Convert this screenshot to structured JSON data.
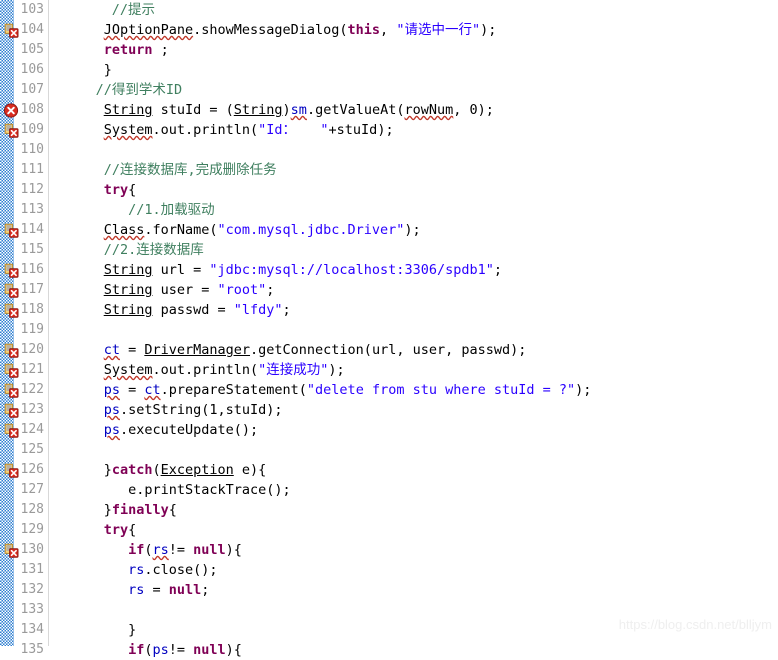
{
  "editor": {
    "name": "java-source-editor",
    "language": "Java",
    "first_line": 103,
    "last_line": 135,
    "colors": {
      "background": "#ffffff",
      "line_number": "#9a9a9a",
      "comment": "#3f7f5f",
      "keyword": "#7f0055",
      "string": "#2a00ff",
      "field": "#0000c0",
      "plain": "#000000",
      "hatch_marker": "#2f7fd0",
      "error_icon": "#d92c20",
      "quickfix_icon": "#f5c242",
      "watermark": "#efefef"
    }
  },
  "watermark": {
    "text": "https://blog.csdn.net/blljym"
  },
  "marker_types": {
    "error": "error-marker-icon",
    "quickfix_error": "quickfix-error-marker-icon",
    "none": ""
  },
  "lines": [
    {
      "number": "103",
      "marker": "none",
      "indent": 7,
      "tokens": [
        {
          "text": "//提示",
          "cls": "t-comment"
        }
      ]
    },
    {
      "number": "104",
      "marker": "quickfix_error",
      "indent": 6,
      "tokens": [
        {
          "text": "JOptionPane",
          "cls": "t-plain sqonly"
        },
        {
          "text": ".showMessageDialog(",
          "cls": "t-plain"
        },
        {
          "text": "this",
          "cls": "t-keyword"
        },
        {
          "text": ", ",
          "cls": "t-plain"
        },
        {
          "text": "\"请选中一行\"",
          "cls": "t-string"
        },
        {
          "text": ");",
          "cls": "t-plain"
        }
      ]
    },
    {
      "number": "105",
      "marker": "none",
      "indent": 6,
      "tokens": [
        {
          "text": "return",
          "cls": "t-keyword"
        },
        {
          "text": " ;",
          "cls": "t-plain"
        }
      ]
    },
    {
      "number": "106",
      "marker": "none",
      "indent": 6,
      "tokens": [
        {
          "text": "}",
          "cls": "t-plain"
        }
      ]
    },
    {
      "number": "107",
      "marker": "none",
      "indent": 5,
      "tokens": [
        {
          "text": "//得到学术ID",
          "cls": "t-comment"
        }
      ]
    },
    {
      "number": "108",
      "marker": "error",
      "indent": 6,
      "tokens": [
        {
          "text": "String",
          "cls": "t-plain ul-sq"
        },
        {
          "text": " stuId = (",
          "cls": "t-plain"
        },
        {
          "text": "String",
          "cls": "t-plain ul-sq"
        },
        {
          "text": ")",
          "cls": "t-plain"
        },
        {
          "text": "sm",
          "cls": "t-field sqonly"
        },
        {
          "text": ".getValueAt(",
          "cls": "t-plain"
        },
        {
          "text": "rowNum",
          "cls": "t-plain sqonly"
        },
        {
          "text": ", 0);",
          "cls": "t-plain"
        }
      ]
    },
    {
      "number": "109",
      "marker": "quickfix_error",
      "indent": 6,
      "tokens": [
        {
          "text": "System",
          "cls": "t-plain sqonly"
        },
        {
          "text": ".out.println(",
          "cls": "t-plain"
        },
        {
          "text": "\"Id：   \"",
          "cls": "t-string"
        },
        {
          "text": "+stuId);",
          "cls": "t-plain"
        }
      ]
    },
    {
      "number": "110",
      "marker": "none",
      "indent": 0,
      "tokens": []
    },
    {
      "number": "111",
      "marker": "none",
      "indent": 6,
      "tokens": [
        {
          "text": "//连接数据库,完成删除任务",
          "cls": "t-comment"
        }
      ]
    },
    {
      "number": "112",
      "marker": "none",
      "indent": 6,
      "tokens": [
        {
          "text": "try",
          "cls": "t-keyword"
        },
        {
          "text": "{",
          "cls": "t-plain"
        }
      ]
    },
    {
      "number": "113",
      "marker": "none",
      "indent": 9,
      "tokens": [
        {
          "text": "//1.加载驱动",
          "cls": "t-comment"
        }
      ]
    },
    {
      "number": "114",
      "marker": "quickfix_error",
      "indent": 6,
      "tokens": [
        {
          "text": "Class",
          "cls": "t-plain sqonly"
        },
        {
          "text": ".forName(",
          "cls": "t-plain"
        },
        {
          "text": "\"com.mysql.jdbc.Driver\"",
          "cls": "t-string"
        },
        {
          "text": ");",
          "cls": "t-plain"
        }
      ]
    },
    {
      "number": "115",
      "marker": "none",
      "indent": 6,
      "tokens": [
        {
          "text": "//2.连接数据库",
          "cls": "t-comment"
        }
      ]
    },
    {
      "number": "116",
      "marker": "quickfix_error",
      "indent": 6,
      "tokens": [
        {
          "text": "String",
          "cls": "t-plain ul-sq"
        },
        {
          "text": " url = ",
          "cls": "t-plain"
        },
        {
          "text": "\"jdbc:mysql://localhost:3306/spdb1\"",
          "cls": "t-string"
        },
        {
          "text": ";",
          "cls": "t-plain"
        }
      ]
    },
    {
      "number": "117",
      "marker": "quickfix_error",
      "indent": 6,
      "tokens": [
        {
          "text": "String",
          "cls": "t-plain ul-sq"
        },
        {
          "text": " user = ",
          "cls": "t-plain"
        },
        {
          "text": "\"root\"",
          "cls": "t-string"
        },
        {
          "text": ";",
          "cls": "t-plain"
        }
      ]
    },
    {
      "number": "118",
      "marker": "quickfix_error",
      "indent": 6,
      "tokens": [
        {
          "text": "String",
          "cls": "t-plain ul-sq"
        },
        {
          "text": " passwd = ",
          "cls": "t-plain"
        },
        {
          "text": "\"lfdy\"",
          "cls": "t-string"
        },
        {
          "text": ";",
          "cls": "t-plain"
        }
      ]
    },
    {
      "number": "119",
      "marker": "none",
      "indent": 0,
      "tokens": []
    },
    {
      "number": "120",
      "marker": "quickfix_error",
      "indent": 6,
      "tokens": [
        {
          "text": "ct",
          "cls": "t-field sqonly"
        },
        {
          "text": " = ",
          "cls": "t-plain"
        },
        {
          "text": "DriverManager",
          "cls": "t-plain ul-sq"
        },
        {
          "text": ".getConnection(",
          "cls": "t-plain"
        },
        {
          "text": "url",
          "cls": "t-plain"
        },
        {
          "text": ", ",
          "cls": "t-plain"
        },
        {
          "text": "user",
          "cls": "t-plain"
        },
        {
          "text": ", ",
          "cls": "t-plain"
        },
        {
          "text": "passwd",
          "cls": "t-plain"
        },
        {
          "text": ");",
          "cls": "t-plain"
        }
      ]
    },
    {
      "number": "121",
      "marker": "quickfix_error",
      "indent": 6,
      "tokens": [
        {
          "text": "System",
          "cls": "t-plain sqonly"
        },
        {
          "text": ".out.println(",
          "cls": "t-plain"
        },
        {
          "text": "\"连接成功\"",
          "cls": "t-string"
        },
        {
          "text": ");",
          "cls": "t-plain"
        }
      ]
    },
    {
      "number": "122",
      "marker": "quickfix_error",
      "indent": 6,
      "tokens": [
        {
          "text": "ps",
          "cls": "t-field sqonly"
        },
        {
          "text": " = ",
          "cls": "t-plain"
        },
        {
          "text": "ct",
          "cls": "t-field sqonly"
        },
        {
          "text": ".prepareStatement(",
          "cls": "t-plain"
        },
        {
          "text": "\"delete from stu where stuId = ?\"",
          "cls": "t-string"
        },
        {
          "text": ");",
          "cls": "t-plain"
        }
      ]
    },
    {
      "number": "123",
      "marker": "quickfix_error",
      "indent": 6,
      "tokens": [
        {
          "text": "ps",
          "cls": "t-field sqonly"
        },
        {
          "text": ".setString(1,stuId);",
          "cls": "t-plain"
        }
      ]
    },
    {
      "number": "124",
      "marker": "quickfix_error",
      "indent": 6,
      "tokens": [
        {
          "text": "ps",
          "cls": "t-field sqonly"
        },
        {
          "text": ".executeUpdate();",
          "cls": "t-plain"
        }
      ]
    },
    {
      "number": "125",
      "marker": "none",
      "indent": 0,
      "tokens": []
    },
    {
      "number": "126",
      "marker": "quickfix_error",
      "indent": 6,
      "tokens": [
        {
          "text": "}",
          "cls": "t-plain"
        },
        {
          "text": "catch",
          "cls": "t-keyword"
        },
        {
          "text": "(",
          "cls": "t-plain"
        },
        {
          "text": "Exception",
          "cls": "t-plain ul-sq"
        },
        {
          "text": " e){",
          "cls": "t-plain"
        }
      ]
    },
    {
      "number": "127",
      "marker": "none",
      "indent": 9,
      "tokens": [
        {
          "text": "e.printStackTrace();",
          "cls": "t-plain"
        }
      ]
    },
    {
      "number": "128",
      "marker": "none",
      "indent": 6,
      "tokens": [
        {
          "text": "}",
          "cls": "t-plain"
        },
        {
          "text": "finally",
          "cls": "t-keyword"
        },
        {
          "text": "{",
          "cls": "t-plain"
        }
      ]
    },
    {
      "number": "129",
      "marker": "none",
      "indent": 6,
      "tokens": [
        {
          "text": "try",
          "cls": "t-keyword"
        },
        {
          "text": "{",
          "cls": "t-plain"
        }
      ]
    },
    {
      "number": "130",
      "marker": "quickfix_error",
      "indent": 9,
      "tokens": [
        {
          "text": "if",
          "cls": "t-keyword"
        },
        {
          "text": "(",
          "cls": "t-plain"
        },
        {
          "text": "rs",
          "cls": "t-field sqonly"
        },
        {
          "text": "!= ",
          "cls": "t-plain"
        },
        {
          "text": "null",
          "cls": "t-keyword"
        },
        {
          "text": "){",
          "cls": "t-plain"
        }
      ]
    },
    {
      "number": "131",
      "marker": "none",
      "indent": 9,
      "tokens": [
        {
          "text": "rs",
          "cls": "t-field"
        },
        {
          "text": ".close();",
          "cls": "t-plain"
        }
      ]
    },
    {
      "number": "132",
      "marker": "none",
      "indent": 9,
      "tokens": [
        {
          "text": "rs",
          "cls": "t-field"
        },
        {
          "text": " = ",
          "cls": "t-plain"
        },
        {
          "text": "null",
          "cls": "t-keyword"
        },
        {
          "text": ";",
          "cls": "t-plain"
        }
      ]
    },
    {
      "number": "133",
      "marker": "none",
      "indent": 0,
      "tokens": []
    },
    {
      "number": "134",
      "marker": "none",
      "indent": 9,
      "tokens": [
        {
          "text": "}",
          "cls": "t-plain"
        }
      ]
    },
    {
      "number": "135",
      "marker": "none",
      "indent": 9,
      "tokens": [
        {
          "text": "if",
          "cls": "t-keyword"
        },
        {
          "text": "(",
          "cls": "t-plain"
        },
        {
          "text": "ps",
          "cls": "t-field"
        },
        {
          "text": "!= ",
          "cls": "t-plain"
        },
        {
          "text": "null",
          "cls": "t-keyword"
        },
        {
          "text": "){",
          "cls": "t-plain"
        }
      ]
    }
  ]
}
